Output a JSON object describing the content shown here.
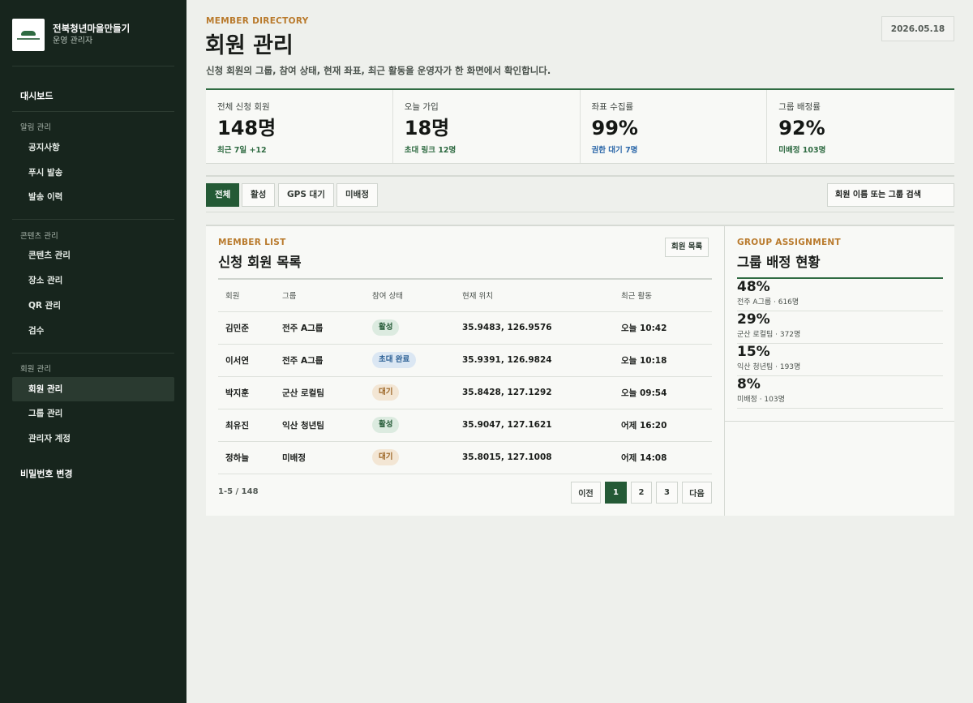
{
  "brand": {
    "name": "전북청년마을만들기",
    "role": "운영 관리자"
  },
  "sidebar": {
    "dashboard": "대시보드",
    "sections": [
      {
        "title": "알림 관리",
        "items": [
          "공지사항",
          "푸시 발송",
          "발송 이력"
        ]
      },
      {
        "title": "콘텐츠 관리",
        "items": [
          "콘텐츠 관리",
          "장소 관리",
          "QR 관리",
          "검수"
        ]
      },
      {
        "title": "회원 관리",
        "items": [
          "회원 관리",
          "그룹 관리",
          "관리자 계정"
        ]
      }
    ],
    "active_item": "회원 관리",
    "password": "비밀번호 변경"
  },
  "header": {
    "eyebrow": "MEMBER DIRECTORY",
    "title": "회원 관리",
    "description": "신청 회원의 그룹, 참여 상태, 현재 좌표, 최근 활동을 운영자가 한 화면에서 확인합니다.",
    "date": "2026.05.18"
  },
  "stats": [
    {
      "label": "전체 신청 회원",
      "value": "148명",
      "note": "최근 7일 +12"
    },
    {
      "label": "오늘 가입",
      "value": "18명",
      "note": "초대 링크 12명"
    },
    {
      "label": "좌표 수집률",
      "value": "99%",
      "note": "권한 대기 7명"
    },
    {
      "label": "그룹 배정률",
      "value": "92%",
      "note": "미배정 103명"
    }
  ],
  "filters": {
    "chips": [
      "전체",
      "활성",
      "GPS 대기",
      "미배정"
    ],
    "active": "전체",
    "search_placeholder": "회원 이름 또는 그룹 검색"
  },
  "member_list": {
    "eyebrow": "MEMBER LIST",
    "title": "신청 회원 목록",
    "button": "회원 목록",
    "columns": [
      "회원",
      "그룹",
      "참여 상태",
      "현재 위치",
      "최근 활동"
    ],
    "rows": [
      {
        "name": "김민준",
        "group": "전주 A그룹",
        "status": "활성",
        "location": "35.9483, 126.9576",
        "last_active": "오늘 10:42"
      },
      {
        "name": "이서연",
        "group": "전주 A그룹",
        "status": "초대 완료",
        "location": "35.9391, 126.9824",
        "last_active": "오늘 10:18"
      },
      {
        "name": "박지훈",
        "group": "군산 로컬팀",
        "status": "대기",
        "location": "35.8428, 127.1292",
        "last_active": "오늘 09:54"
      },
      {
        "name": "최유진",
        "group": "익산 청년팀",
        "status": "활성",
        "location": "35.9047, 127.1621",
        "last_active": "어제 16:20"
      },
      {
        "name": "정하늘",
        "group": "미배정",
        "status": "대기",
        "location": "35.8015, 127.1008",
        "last_active": "어제 14:08"
      }
    ],
    "range": "1-5 / 148",
    "pagination": {
      "prev": "이전",
      "pages": [
        "1",
        "2",
        "3"
      ],
      "current": "1",
      "next": "다음"
    }
  },
  "group_assignment": {
    "eyebrow": "GROUP ASSIGNMENT",
    "title": "그룹 배정 현황",
    "items": [
      {
        "percent": "48%",
        "label": "전주 A그룹 · 616명"
      },
      {
        "percent": "29%",
        "label": "군산 로컬팀 · 372명"
      },
      {
        "percent": "15%",
        "label": "익산 청년팀 · 193명"
      },
      {
        "percent": "8%",
        "label": "미배정 · 103명"
      }
    ]
  },
  "colors": {
    "sidebar_bg": "#17251d",
    "accent_green": "#245a36",
    "eyebrow_orange": "#b97a2c",
    "link_blue": "#2a66a8"
  }
}
